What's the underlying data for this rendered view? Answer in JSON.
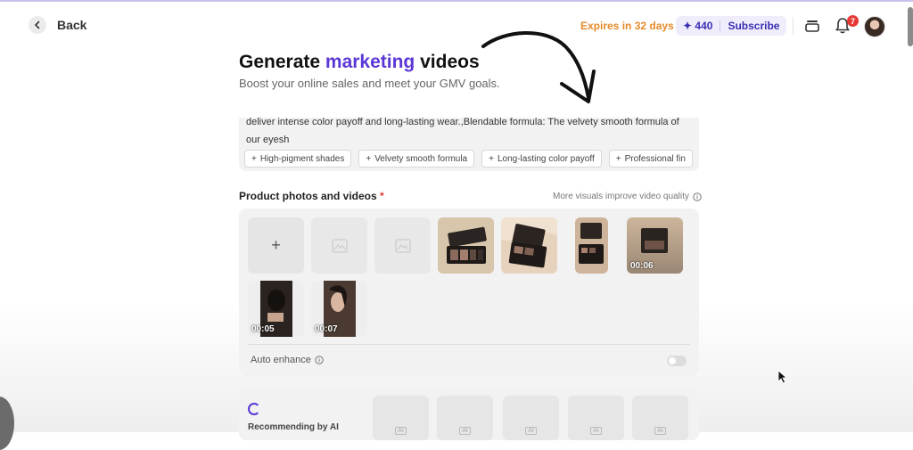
{
  "header": {
    "back_label": "Back",
    "expires": "Expires in 32 days",
    "credits": "440",
    "subscribe": "Subscribe",
    "notification_count": "7"
  },
  "page": {
    "title_part1": "Generate ",
    "title_accent": "marketing",
    "title_part2": " videos",
    "subtitle": "Boost your online sales and meet your GMV goals."
  },
  "description": {
    "text": "deliver intense color payoff and long-lasting wear.,Blendable formula: The velvety smooth formula of our eyesh",
    "chips": [
      "High-pigment shades",
      "Velvety smooth formula",
      "Long-lasting color payoff",
      "Professional fin"
    ]
  },
  "media": {
    "label": "Product photos and videos",
    "required_mark": "*",
    "hint": "More visuals improve video quality",
    "add_symbol": "+",
    "durations": [
      "00:06",
      "00:05",
      "00:07"
    ],
    "auto_enhance_label": "Auto enhance",
    "auto_enhance_on": false
  },
  "recommended": {
    "label": "Recommending by AI",
    "ai_mark": "AI"
  },
  "colors": {
    "accent": "#5b37d6",
    "expires": "#e58a2a",
    "badge": "#e53935"
  }
}
